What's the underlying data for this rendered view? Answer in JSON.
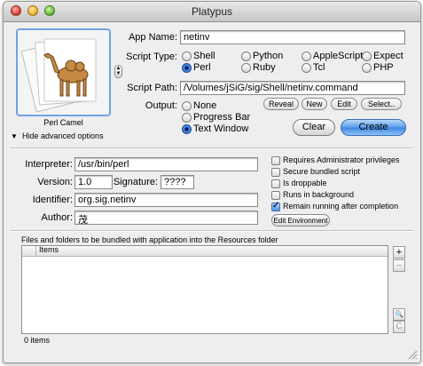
{
  "window": {
    "title": "Platypus"
  },
  "icon_caption": "Perl Camel",
  "app_name": {
    "label": "App Name:",
    "value": "netinv"
  },
  "script_type": {
    "label": "Script Type:",
    "options": [
      "Shell",
      "Python",
      "AppleScript",
      "Expect",
      "Perl",
      "Ruby",
      "Tcl",
      "PHP"
    ],
    "selected": "Perl"
  },
  "script_path": {
    "label": "Script Path:",
    "value": "/Volumes/jSiG/sig/Shell/netinv.command"
  },
  "path_buttons": {
    "reveal": "Reveal",
    "new": "New",
    "edit": "Edit",
    "select": "Select.."
  },
  "output": {
    "label": "Output:",
    "options": [
      "None",
      "Progress Bar",
      "Text Window"
    ],
    "selected": "Text Window"
  },
  "actions": {
    "clear": "Clear",
    "create": "Create"
  },
  "advanced_toggle": "Hide advanced options",
  "interpreter": {
    "label": "Interpreter:",
    "value": "/usr/bin/perl"
  },
  "version": {
    "label": "Version:",
    "value": "1.0"
  },
  "signature": {
    "label": "Signature:",
    "value": "????"
  },
  "identifier": {
    "label": "Identifier:",
    "value": "org.sig.netinv"
  },
  "author": {
    "label": "Author:",
    "value": "茂"
  },
  "checkboxes": [
    {
      "label": "Requires Administrator privileges",
      "checked": false
    },
    {
      "label": "Secure bundled script",
      "checked": false
    },
    {
      "label": "Is droppable",
      "checked": false
    },
    {
      "label": "Runs in background",
      "checked": false
    },
    {
      "label": "Remain running after completion",
      "checked": true
    }
  ],
  "edit_env_button": "Edit Environment",
  "files": {
    "description": "Files and folders to be bundled with application into the Resources folder",
    "column_header": "Items",
    "count_text": "0 items",
    "add_label": "+",
    "remove_label": "−",
    "reveal_icon_label": "C"
  },
  "colors": {
    "default_button": "#3f86e2",
    "window_bg": "#eeeeee"
  }
}
